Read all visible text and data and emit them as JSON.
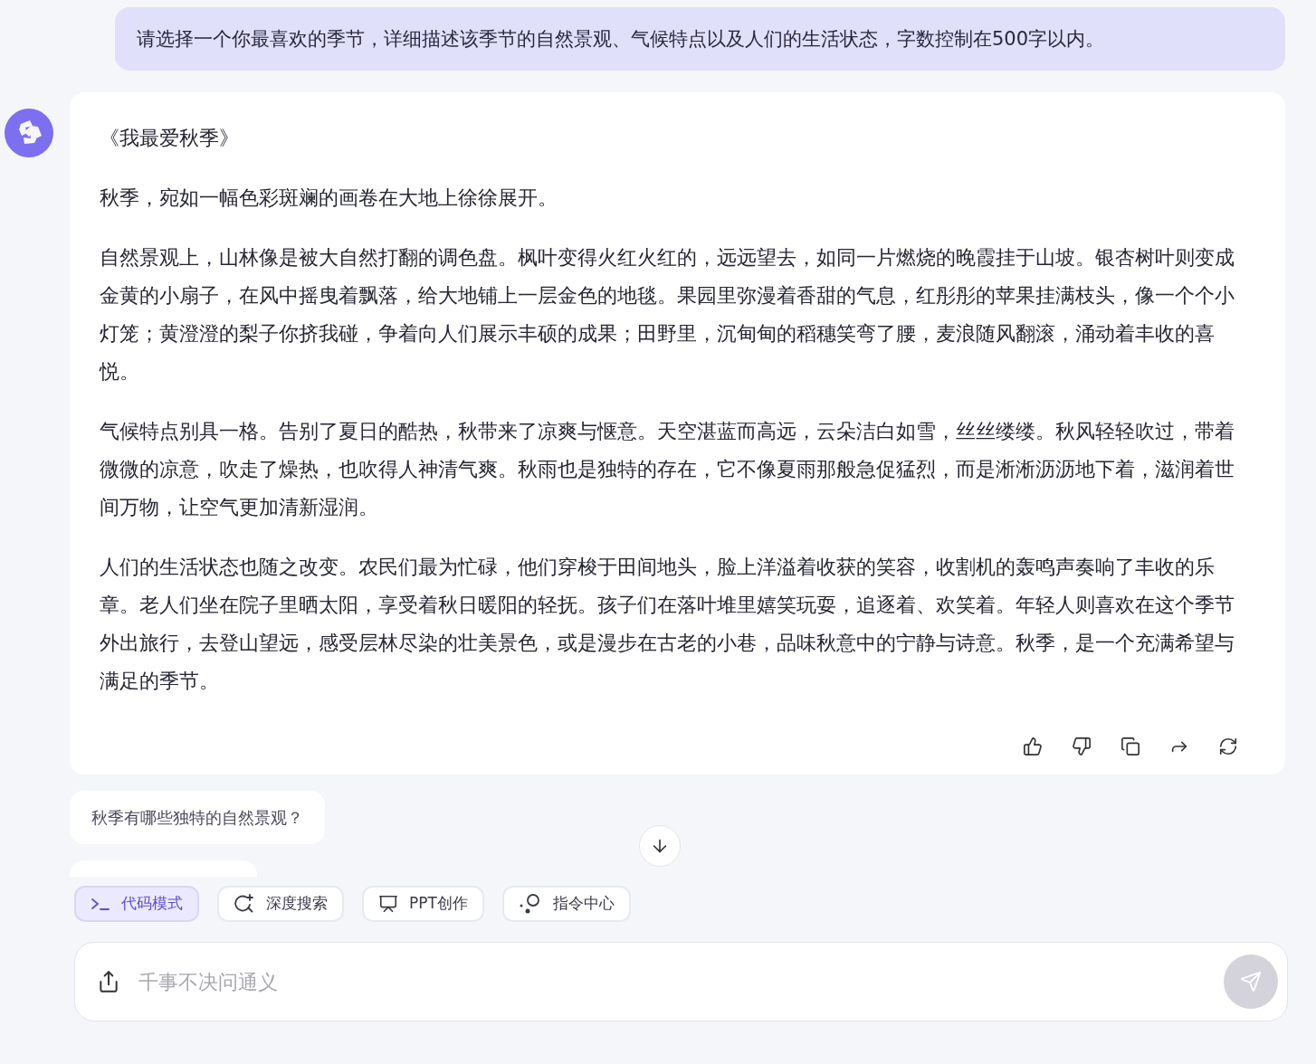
{
  "user_message": "请选择一个你最喜欢的季节，详细描述该季节的自然景观、气候特点以及人们的生活状态，字数控制在500字以内。",
  "reply": {
    "title": "《我最爱秋季》",
    "paragraphs": [
      "秋季，宛如一幅色彩斑斓的画卷在大地上徐徐展开。",
      "自然景观上，山林像是被大自然打翻的调色盘。枫叶变得火红火红的，远远望去，如同一片燃烧的晚霞挂于山坡。银杏树叶则变成金黄的小扇子，在风中摇曳着飘落，给大地铺上一层金色的地毯。果园里弥漫着香甜的气息，红彤彤的苹果挂满枝头，像一个个小灯笼；黄澄澄的梨子你挤我碰，争着向人们展示丰硕的成果；田野里，沉甸甸的稻穗笑弯了腰，麦浪随风翻滚，涌动着丰收的喜悦。",
      "气候特点别具一格。告别了夏日的酷热，秋带来了凉爽与惬意。天空湛蓝而高远，云朵洁白如雪，丝丝缕缕。秋风轻轻吹过，带着微微的凉意，吹走了燥热，也吹得人神清气爽。秋雨也是独特的存在，它不像夏雨那般急促猛烈，而是淅淅沥沥地下着，滋润着世间万物，让空气更加清新湿润。",
      "人们的生活状态也随之改变。农民们最为忙碌，他们穿梭于田间地头，脸上洋溢着收获的笑容，收割机的轰鸣声奏响了丰收的乐章。老人们坐在院子里晒太阳，享受着秋日暖阳的轻抚。孩子们在落叶堆里嬉笑玩耍，追逐着、欢笑着。年轻人则喜欢在这个季节外出旅行，去登山望远，感受层林尽染的壮美景色，或是漫步在古老的小巷，品味秋意中的宁静与诗意。秋季，是一个充满希望与满足的季节。"
    ],
    "actions": [
      {
        "kind": "like"
      },
      {
        "kind": "dislike"
      },
      {
        "kind": "copy"
      },
      {
        "kind": "share"
      },
      {
        "kind": "regenerate"
      }
    ]
  },
  "suggestions": [
    "秋季有哪些独特的自然景观？"
  ],
  "tools": [
    {
      "kind": "code",
      "label": "代码模式",
      "selected": true
    },
    {
      "kind": "search",
      "label": "深度搜索",
      "selected": false
    },
    {
      "kind": "ppt",
      "label": "PPT创作",
      "selected": false
    },
    {
      "kind": "commands",
      "label": "指令中心",
      "selected": false
    }
  ],
  "input": {
    "placeholder": "千事不决问通义"
  }
}
